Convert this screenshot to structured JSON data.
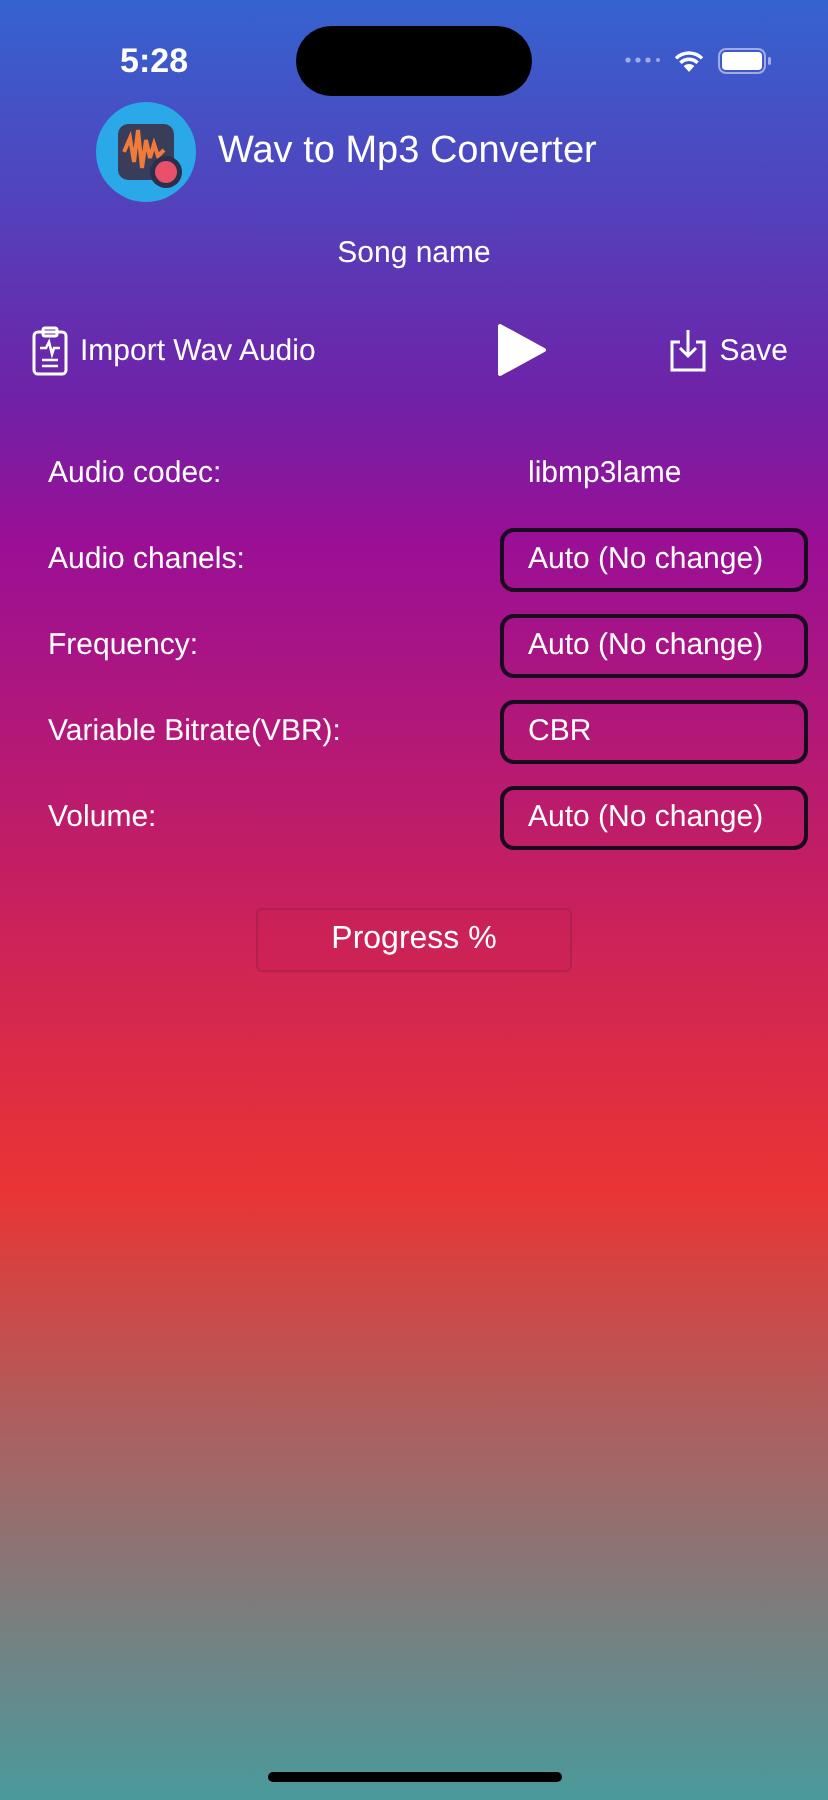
{
  "status_bar": {
    "time": "5:28"
  },
  "header": {
    "title": "Wav to Mp3 Converter"
  },
  "song_name": "Song name",
  "toolbar": {
    "import_label": "Import Wav Audio",
    "save_label": "Save"
  },
  "settings": [
    {
      "label": "Audio codec:",
      "value": "libmp3lame",
      "kind": "text"
    },
    {
      "label": "Audio chanels:",
      "value": "Auto (No change)",
      "kind": "select"
    },
    {
      "label": "Frequency:",
      "value": "Auto (No change)",
      "kind": "select"
    },
    {
      "label": "Variable Bitrate(VBR):",
      "value": "CBR",
      "kind": "select"
    },
    {
      "label": "Volume:",
      "value": "Auto (No change)",
      "kind": "select"
    }
  ],
  "progress": {
    "label": "Progress %"
  }
}
